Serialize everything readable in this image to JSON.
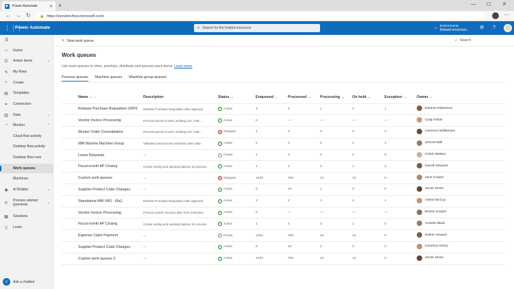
{
  "browser": {
    "tab_title": "Power Automate",
    "url": "https://preview.flow.microsoft.com/"
  },
  "header": {
    "app_name": "Power Automate",
    "search_placeholder": "Search for the helpful resources",
    "env_label": "Environments",
    "env_name": "Default environm..."
  },
  "sidebar": {
    "items": [
      {
        "label": "Home",
        "icon": "home-icon"
      },
      {
        "label": "Action items",
        "icon": "checklist-icon",
        "chevron": true
      },
      {
        "label": "My flows",
        "icon": "flow-icon"
      },
      {
        "label": "Create",
        "icon": "plus-icon"
      },
      {
        "label": "Templates",
        "icon": "template-icon"
      },
      {
        "label": "Connectors",
        "icon": "connector-icon"
      },
      {
        "label": "Data",
        "icon": "database-icon",
        "chevron": true
      },
      {
        "label": "Monitor",
        "icon": "monitor-icon",
        "chevron": true
      },
      {
        "label": "Cloud flow activity",
        "sub": true
      },
      {
        "label": "Desktop flow activity",
        "sub": true
      },
      {
        "label": "Desktop flow runs",
        "sub": true
      },
      {
        "label": "Work queues",
        "sub": true,
        "active": true
      },
      {
        "label": "Machines",
        "sub": true
      },
      {
        "label": "AI Builder",
        "icon": "ai-icon",
        "chevron": true
      },
      {
        "label": "Process advisor (preview)",
        "icon": "process-icon",
        "chevron": true
      },
      {
        "label": "Solutions",
        "icon": "solutions-icon"
      },
      {
        "label": "Learn",
        "icon": "book-icon"
      }
    ],
    "chatbot_label": "Ask a chatbot"
  },
  "commandbar": {
    "new_label": "New work queue",
    "search_label": "Search"
  },
  "main": {
    "title": "Work queues",
    "description": "Use work queues to store, prioritize, distribute and process work items.",
    "learn_more": "Learn more",
    "tabs": [
      "Process queues",
      "Machine queues",
      "Machine group queues"
    ],
    "columns": [
      "Name",
      "Description",
      "Status",
      "Enqueued",
      "Processed",
      "Processing",
      "On hold",
      "Exception",
      "Owner"
    ],
    "rows": [
      {
        "name": "Release Purchase Requisition GRP2",
        "desc": "Release Purchase Requisition after approval",
        "status": "Active",
        "enq": "3",
        "proc": "2",
        "procing": "1",
        "hold": "4",
        "exc": "1",
        "owner": "Darlene Robertson"
      },
      {
        "name": "Vendor Invoice Processing",
        "desc": "Process permit to work, welding cert, CSE...",
        "status": "Active",
        "enq": "0",
        "proc": "—",
        "procing": "—",
        "hold": "—",
        "exc": "—",
        "owner": "Cody Fisher"
      },
      {
        "name": "Worker Order Consolidation",
        "desc": "Process permit to work, welding cert, CSE...",
        "status": "Stopped",
        "enq": "1",
        "proc": "0",
        "procing": "0",
        "hold": "0",
        "exc": "3",
        "owner": "Cameron Williamson"
      },
      {
        "name": "IBM Maximo Machine Group",
        "desc": "Validated and process extracted claim data",
        "status": "Active",
        "enq": "2",
        "proc": "0",
        "procing": "0",
        "hold": "1",
        "exc": "1",
        "owner": "Jerome Bell"
      },
      {
        "name": "Leave Requests",
        "desc": "—",
        "status": "Pause",
        "enq": "1",
        "proc": "0",
        "procing": "0",
        "hold": "5",
        "exc": "8",
        "owner": "Kristin Watson"
      },
      {
        "name": "Fiscal month AP Closing",
        "desc": "Create ending and opening balance for process",
        "status": "Active",
        "enq": "1",
        "proc": "4",
        "procing": "3",
        "hold": "1",
        "exc": "2",
        "owner": "Darrell Steward"
      },
      {
        "name": "Custom work queues",
        "desc": "—",
        "status": "Stopped",
        "enq": "1333",
        "proc": "783",
        "procing": "13",
        "hold": "12",
        "exc": "0",
        "owner": "Jane Cooper"
      },
      {
        "name": "Supplier Product Code Changes",
        "desc": "—",
        "status": "Active",
        "enq": "5",
        "proc": "23",
        "procing": "1",
        "hold": "0",
        "exc": "0",
        "owner": "Jacob Jones"
      },
      {
        "name": "Standalone MM VM1 - Ma1",
        "desc": "Release Purchase Requisition after approval",
        "status": "Active",
        "enq": "3",
        "proc": "2",
        "procing": "1",
        "hold": "4",
        "exc": "1",
        "owner": "Arlene McCoy"
      },
      {
        "name": "Vendor Invoice Processing",
        "desc": "Process vendor invoices after form extraction",
        "status": "Active",
        "enq": "0",
        "proc": "—",
        "procing": "—",
        "hold": "—",
        "exc": "—",
        "owner": "Bessie Cooper"
      },
      {
        "name": "Fiscal month AP Closing",
        "desc": "Create ending and opening balance for process",
        "status": "Active",
        "enq": "1",
        "proc": "4",
        "procing": "3",
        "hold": "1",
        "exc": "0",
        "owner": "Annette Black"
      },
      {
        "name": "Expense Claim Payment",
        "desc": "—",
        "status": "Pause",
        "enq": "1333",
        "proc": "765",
        "procing": "13",
        "hold": "12",
        "exc": "0",
        "owner": "Esther Howard"
      },
      {
        "name": "Supplier Product Code Changes",
        "desc": "—",
        "status": "Active",
        "enq": "5",
        "proc": "23",
        "procing": "1",
        "hold": "0",
        "exc": "0",
        "owner": "Courtney Henry"
      },
      {
        "name": "Custom work queues 2",
        "desc": "—",
        "status": "Active",
        "enq": "1333",
        "proc": "783",
        "procing": "13",
        "hold": "12",
        "exc": "0",
        "owner": "Jacob Jones"
      }
    ]
  },
  "colors": {
    "accent": "#0f6cbd",
    "active_green": "#107c10",
    "stopped_red": "#c50f1f"
  }
}
